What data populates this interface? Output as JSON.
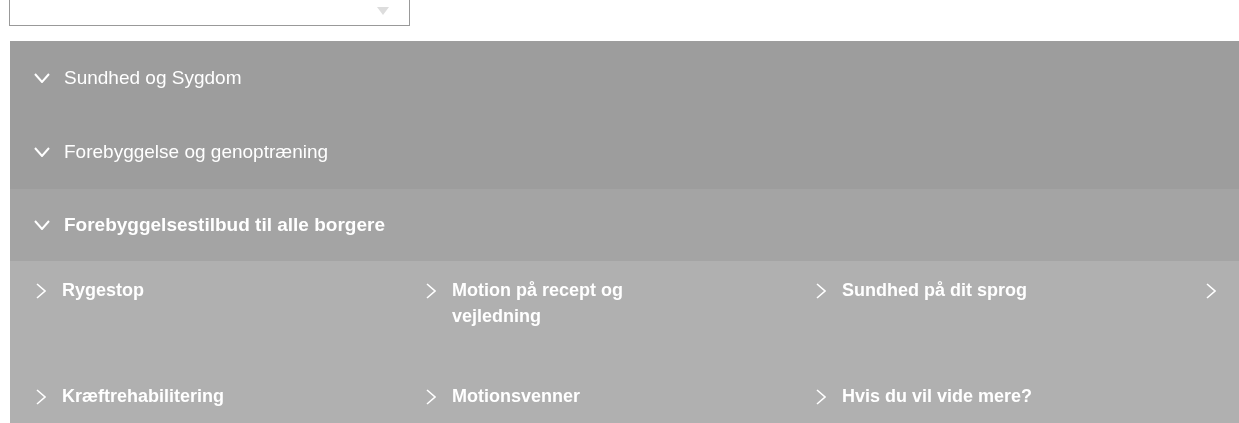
{
  "sections": [
    {
      "label": "Sundhed og Sygdom",
      "expanded": true,
      "bold": false
    },
    {
      "label": "Forebyggelse og genoptræning",
      "expanded": true,
      "bold": false
    },
    {
      "label": "Forebyggelsestilbud til alle borgere",
      "expanded": true,
      "bold": true
    }
  ],
  "links": [
    {
      "kind": "link",
      "label": "Rygestop"
    },
    {
      "kind": "link",
      "label": "Motion på recept og vejledning"
    },
    {
      "kind": "link",
      "label": "Sundhed på dit sprog"
    },
    {
      "kind": "cut"
    },
    {
      "kind": "link",
      "label": "Kræftrehabilitering"
    },
    {
      "kind": "link",
      "label": "Motionsvenner"
    },
    {
      "kind": "link",
      "label": "Hvis du vil vide mere?"
    }
  ]
}
